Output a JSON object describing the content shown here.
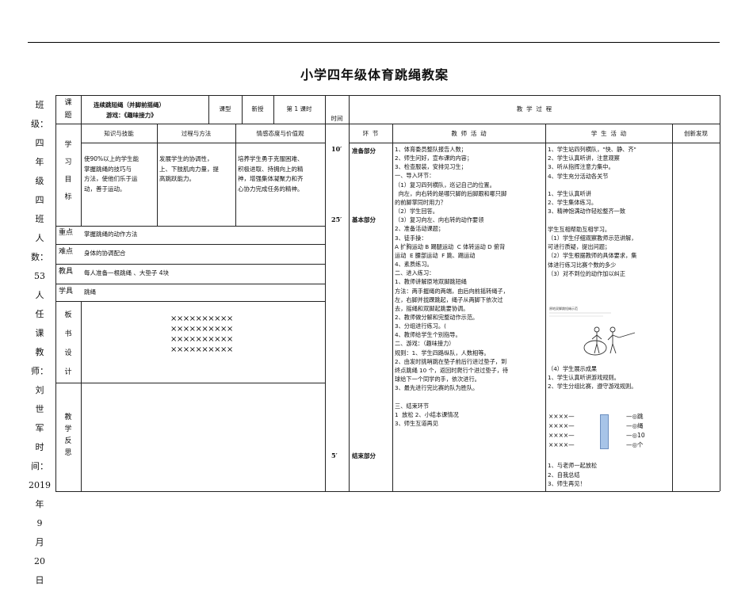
{
  "title": "小学四年级体育跳绳教案",
  "side_info": [
    "班",
    "级：",
    "四",
    "年",
    "级",
    "四",
    "班",
    "人",
    "数：",
    "53",
    "人",
    "任",
    "课",
    "教",
    "师：",
    "刘",
    "世",
    "军",
    "时",
    "间：",
    "2019",
    "年",
    "9",
    "月",
    "20",
    "日"
  ],
  "lesson": {
    "ketilabel": "课题",
    "topic1": "连续跳短绳（并脚前摇绳）",
    "topic2": "游戏：《趣味接力》",
    "type_label": "课型",
    "type_value": "新授",
    "period": "第 1 课时",
    "time_label": "时间",
    "process_label": "教  学  过  程"
  },
  "goals": {
    "label": "学习目标",
    "col1_head": "知识与技能",
    "col2_head": "过程与方法",
    "col3_head": "情感态度与价值观",
    "col1": "使90%以上的学生能\n掌握跳绳的技巧与\n方法，使他们乐于运\n动，善于运动。",
    "col2": "发展学生的协调性，\n上、下肢肌肉力量，提\n高跳跃能力。",
    "col3": "培养学生勇于克服困难、\n积极进取、持拥向上的精\n神，增强集体凝聚力和齐\n心协力完成任务的精神。"
  },
  "rows": [
    {
      "label": "重点",
      "value": "掌握跳绳的动作方法"
    },
    {
      "label": "难点",
      "value": "身体的协调配合"
    },
    {
      "label": "教具",
      "value": "每人准备一根跳绳 、大垫子 4块"
    },
    {
      "label": "学具",
      "value": "跳绳"
    }
  ],
  "board": {
    "label": "板书设计",
    "lines": [
      "××××××××××",
      "××××××××××",
      "××××××××××",
      "××××××××××"
    ]
  },
  "reflection_label": "教学反思",
  "process_headers": {
    "section": "环  节",
    "teacher": "教  师  活  动",
    "student": "学  生  活  动",
    "innovation": "创新发现"
  },
  "times": [
    "10′",
    "25′",
    "5′"
  ],
  "sections": [
    "准备部分",
    "基本部分",
    "结束部分"
  ],
  "teacher_activity": "1、体育委员整队报告人数；\n2、师生问好，宣布课的内容；\n3、检查服装，安排见习生；\n一、导入环节：\n（1）复习四列横队，巡记自己的位置。\n  向左，向右转的是哪只脚的后脚跟和哪只脚\n的前脚掌同时用力？\n（2）学生回答。\n（3）复习向左、向右转的动作要领\n2、准备活动课题；\n3、徒手操：\nA 扩胸运动 B 踢腿运动  C 体转运动 D 俯背\n运动  E 腰部运动  F 跳、踢运动\n4、素质练习。\n二、进入练习：\n1、教师讲解原地双脚跳短绳\n方法：两手握绳的两端，由后向前摇转绳子，\n左，右脚并拢踝跳起，绳子从两脚下依次过\n去，摇绳和双脚起跳要协调。\n2、教师做分解和完整动作示范。\n3、分组进行练习。(\n4、教师给学生个别指导。\n二、游戏：（趣味接力）\n规则：1、学生四路纵队，人数相等。\n2、由发时挑哨跳在垫子前后行进过垫子，到\n终点跳绳 10 个，返回时爬行个进过垫子，待\n球给下一个同学的手，依次进行。\n3、最先进行完比赛的队为胜队。\n\n三、结束环节\n1  放松 2、小结本课情况\n3、师生互道再见",
  "student_activity_top": "1、学生站四列横队，\"快、静、齐\"\n2、学生认真听讲，注意观察\n3、听从指挥注意力集中。\n4、学生充分活动各关节\n\n1、学生认真听讲\n2、学生集体练习。\n3、精神饱满动作轻松整齐一致\n\n学生互相帮助互相学习。\n（1）学生仔细观察教师示范讲解，\n可进行质疑，提出问题；\n（2）学生根据教师的具体要求，集\n体进行练习比赛个数的多少\n（3）对不到位的动作加以纠正",
  "picture_caption": "原地双脚跳短绳示范",
  "student_activity_mid": "（4）学生展示成果\n1、学生认真听讲游戏规则。\n2、学生分组比赛，遵守游戏规则。",
  "formation": {
    "rows": [
      "××××—",
      "××××—",
      "××××—",
      "××××—"
    ],
    "ends": [
      "—◎跳",
      "—◎绳",
      "—◎10",
      "—◎个"
    ]
  },
  "student_activity_end": "1、与老师一起放松\n2、自我总结\n3、师生再见！"
}
